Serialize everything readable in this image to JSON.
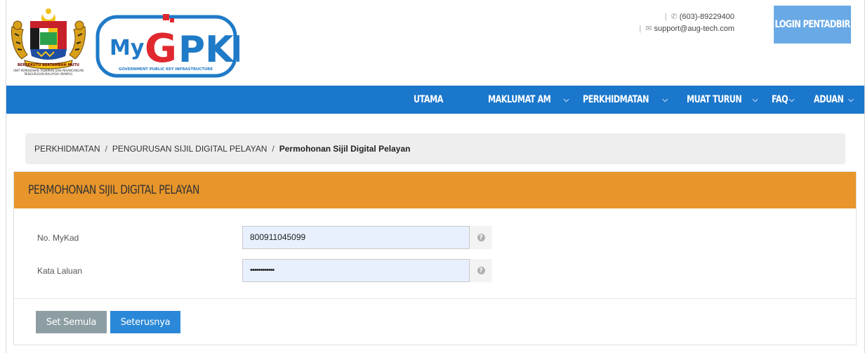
{
  "header": {
    "crest_caption": "UNIT PEMODENAN TADBIRAN DAN PERANCANGAN PENGURUSAN MALAYSIA (MAMPU)",
    "logo_text": "MyGPKI",
    "logo_tagline": "GOVERNMENT PUBLIC KEY INFRASTRUCTURE",
    "phone": "(603)-89229400",
    "email": "support@aug-tech.com",
    "login_label": "LOGIN PENTADBIR"
  },
  "nav": {
    "items": [
      {
        "label": "UTAMA",
        "dropdown": false
      },
      {
        "label": "MAKLUMAT AM",
        "dropdown": true
      },
      {
        "label": "PERKHIDMATAN",
        "dropdown": true
      },
      {
        "label": "MUAT TURUN",
        "dropdown": true
      },
      {
        "label": "FAQ",
        "dropdown": true
      },
      {
        "label": "ADUAN",
        "dropdown": true
      }
    ]
  },
  "breadcrumb": {
    "items": [
      "PERKHIDMATAN",
      "PENGURUSAN SIJIL DIGITAL PELAYAN"
    ],
    "active": "Permohonan Sijil Digital Pelayan"
  },
  "form": {
    "title": "PERMOHONAN SIJIL DIGITAL PELAYAN",
    "mykad_label": "No. MyKad",
    "mykad_value": "800911045099",
    "password_label": "Kata Laluan",
    "password_value": "••••••••••••",
    "help_glyph": "?",
    "reset_label": "Set Semula",
    "next_label": "Seterusnya"
  },
  "colors": {
    "nav_blue": "#1a77cc",
    "login_blue": "#68a9e6",
    "panel_orange": "#e8962b",
    "reset_gray": "#8d9ea3",
    "next_blue": "#2b88d8",
    "input_fill": "#e8f0fe"
  },
  "icons": [
    "crest-emblem-icon",
    "mygpki-logo",
    "phone-icon",
    "envelope-icon",
    "chevron-down-icon",
    "help-icon"
  ]
}
